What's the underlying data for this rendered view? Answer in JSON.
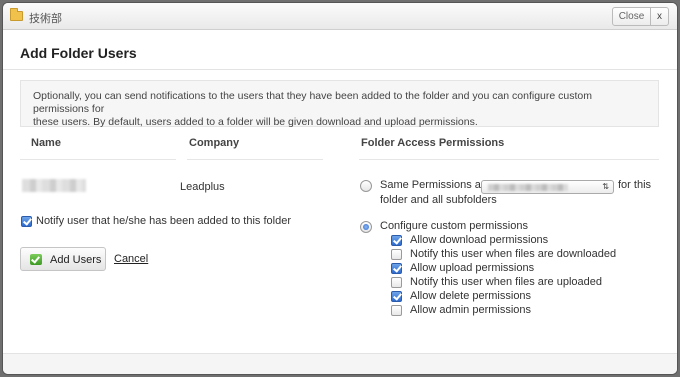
{
  "window": {
    "title": "技術部",
    "close_label": "Close",
    "x_label": "x"
  },
  "dialog": {
    "heading": "Add Folder Users",
    "info_line1": "Optionally, you can send notifications to the users that they have been added to the folder and you can configure custom permissions for",
    "info_line2": "these users. By default, users added to a folder will be given download and upload permissions."
  },
  "table": {
    "name_header": "Name",
    "company_header": "Company",
    "rows": [
      {
        "name": "",
        "company": "Leadplus"
      }
    ]
  },
  "notify": {
    "label": "Notify user that he/she has been added to this folder",
    "checked": true
  },
  "actions": {
    "add_users_label": "Add Users",
    "cancel_label": "Cancel"
  },
  "permissions": {
    "header": "Folder Access Permissions",
    "same_as_label": "Same Permissions as",
    "same_as_suffix_line1": "for this",
    "same_as_suffix_line2": "folder and all subfolders",
    "same_as_selected": false,
    "custom_label": "Configure custom permissions",
    "custom_selected": true,
    "options": [
      {
        "label": "Allow download permissions",
        "checked": true
      },
      {
        "label": "Notify this user when files are downloaded",
        "checked": false
      },
      {
        "label": "Allow upload permissions",
        "checked": true
      },
      {
        "label": "Notify this user when files are uploaded",
        "checked": false
      },
      {
        "label": "Allow delete permissions",
        "checked": true
      },
      {
        "label": "Allow admin permissions",
        "checked": false
      }
    ]
  },
  "colors": {
    "accent": "#2e6bd1",
    "success": "#3e9a25",
    "overlay": "#6f6f6f"
  }
}
